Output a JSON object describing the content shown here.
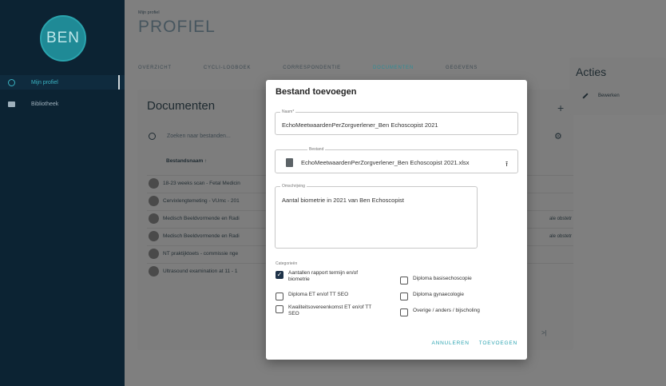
{
  "sidebar": {
    "logo": "BEN",
    "items": [
      {
        "label": "Mijn profiel",
        "icon": "person-circle-icon"
      },
      {
        "label": "Bibliotheek",
        "icon": "folder-icon"
      }
    ]
  },
  "header": {
    "breadcrumb": "Mijn profiel",
    "title": "PROFIEL"
  },
  "tabs": [
    "OVERZICHT",
    "CYCLI-LOGBOEK",
    "CORRESPONDENTIE",
    "DOCUMENTEN",
    "GEGEVENS"
  ],
  "documents": {
    "title": "Documenten",
    "add_label": "+",
    "search_placeholder": "Zoeken naar bestanden...",
    "column_header": "Bestandsnaam ↑",
    "rows": [
      {
        "name": "18-23 weeks scan - Fetal Medicin",
        "extra": ""
      },
      {
        "name": "Cervixlengtemeting - VUmc - 201",
        "extra": ""
      },
      {
        "name": "Medisch Beeldvormende en Radi",
        "extra": "ale obstetr"
      },
      {
        "name": "Medisch Beeldvormende en Radi",
        "extra": "ale obstetr"
      },
      {
        "name": "NT praktijktoets - commissie nge",
        "extra": ""
      },
      {
        "name": "Ultrasound examination at 11 - 1",
        "extra": ""
      }
    ],
    "pager": ">|"
  },
  "actions": {
    "title": "Acties",
    "edit_label": "Bewerken"
  },
  "modal": {
    "title": "Bestand toevoegen",
    "name_label": "Naam*",
    "name_value": "EchoMeetwaardenPerZorgverlener_Ben Echoscopist 2021",
    "file_label": "Bestand",
    "file_value": "EchoMeetwaardenPerZorgverlener_Ben Echoscopist 2021.xlsx",
    "desc_label": "Omschrijving",
    "desc_value": "Aantal biometrie in 2021 van Ben Echoscopist",
    "categories_label": "Categorieën",
    "categories": [
      {
        "label": "Aantallen rapport termijn en/of biometrie",
        "checked": true
      },
      {
        "label": "Diploma basisechoscopie",
        "checked": false
      },
      {
        "label": "Diploma ET en/of TT SEO",
        "checked": false
      },
      {
        "label": "Diploma gynaecologie",
        "checked": false
      },
      {
        "label": "Kwaliteitsovereenkomst ET en/of TT SEO",
        "checked": false
      },
      {
        "label": "Overige / anders / bijscholing",
        "checked": false
      }
    ],
    "cancel_label": "ANNULEREN",
    "submit_label": "TOEVOEGEN"
  }
}
